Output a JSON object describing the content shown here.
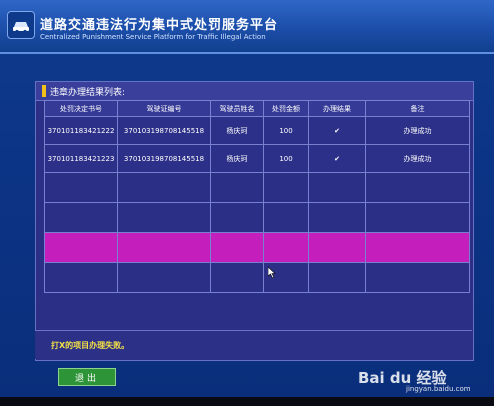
{
  "header": {
    "title": "道路交通违法行为集中式处罚服务平台",
    "subtitle": "Centralized Punishment Service Platform for Traffic Illegal Action"
  },
  "panel": {
    "title": "违章办理结果列表:"
  },
  "table": {
    "columns": [
      "处罚决定书号",
      "驾驶证编号",
      "驾驶员姓名",
      "处罚金额",
      "办理结果",
      "备注"
    ],
    "rows": [
      {
        "decision_no": "370101183421222",
        "license_no": "370103198708145518",
        "driver": "杨庆珂",
        "amount": "100",
        "result": "✔",
        "remark": "办理成功"
      },
      {
        "decision_no": "370101183421223",
        "license_no": "370103198708145518",
        "driver": "杨庆珂",
        "amount": "100",
        "result": "✔",
        "remark": "办理成功"
      }
    ]
  },
  "footer": {
    "message": "打X的项目办理失败。"
  },
  "buttons": {
    "exit_label": "退出"
  },
  "watermark": {
    "text": "Bai du 经验",
    "sub": "jingyan.baidu.com"
  },
  "colors": {
    "highlight_row": "#c41fbd",
    "check": "#3ee042",
    "warning_text": "#f4e046"
  }
}
